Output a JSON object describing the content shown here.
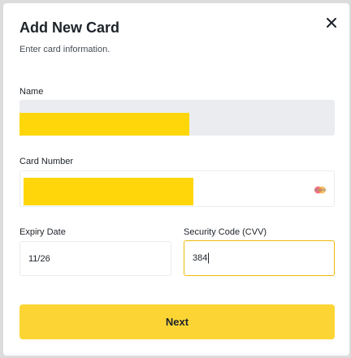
{
  "modal": {
    "title": "Add New Card",
    "subtitle": "Enter card information.",
    "close_icon": "close-icon"
  },
  "form": {
    "name": {
      "label": "Name",
      "value": ""
    },
    "card_number": {
      "label": "Card Number",
      "value": "",
      "brand_icon": "mastercard-icon"
    },
    "expiry": {
      "label": "Expiry Date",
      "value": "11/26"
    },
    "cvv": {
      "label": "Security Code (CVV)",
      "value": "384",
      "focused": true
    }
  },
  "actions": {
    "next_label": "Next"
  },
  "colors": {
    "accent": "#fcd535",
    "focus_border": "#f0b90b",
    "redaction": "#ffd60a"
  }
}
